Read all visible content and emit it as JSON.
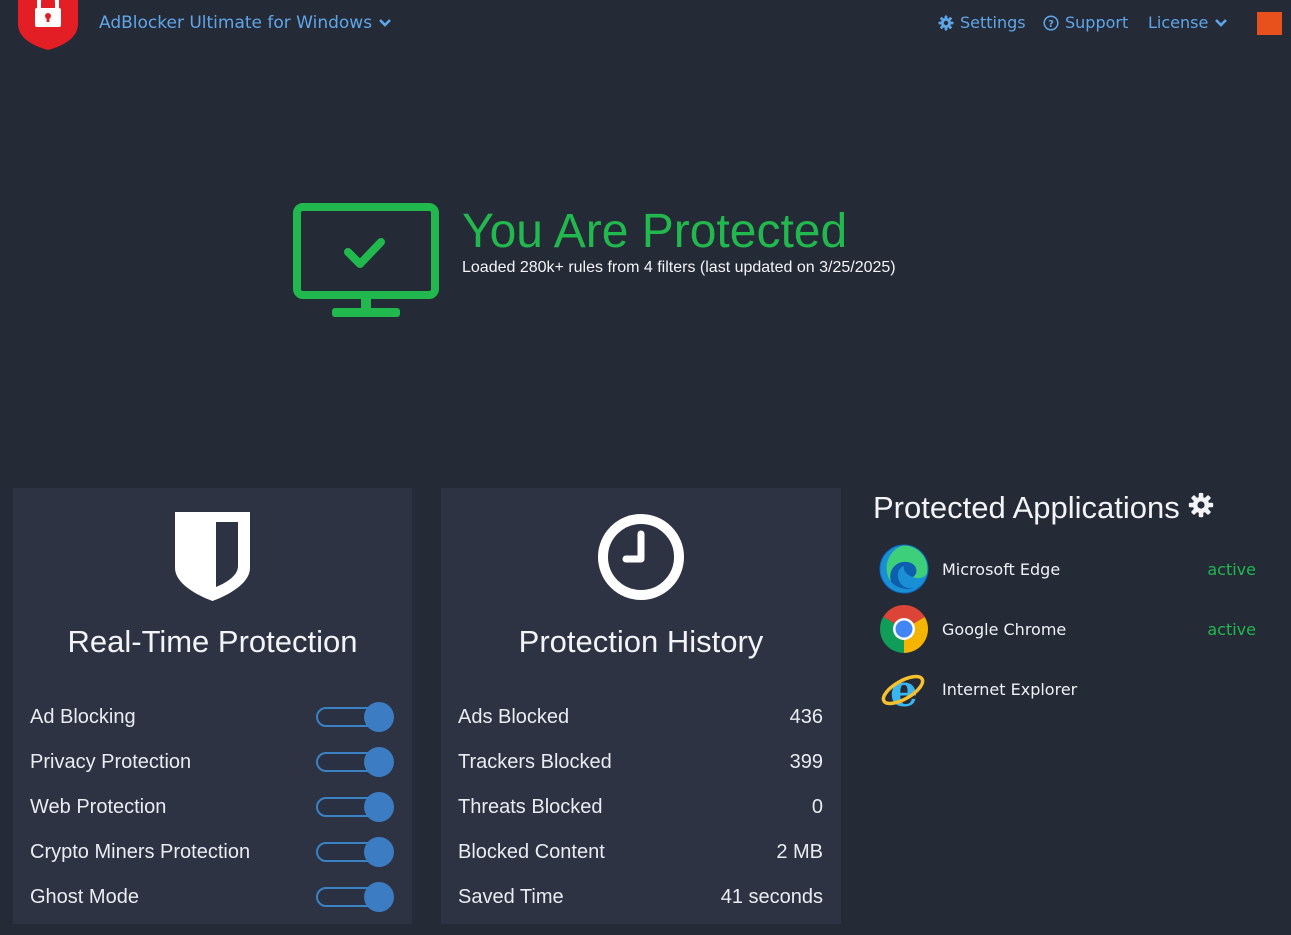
{
  "header": {
    "app_title": "AdBlocker Ultimate for Windows",
    "settings_label": "Settings",
    "support_label": "Support",
    "license_label": "License"
  },
  "hero": {
    "title": "You Are Protected",
    "subtitle": "Loaded 280k+ rules from 4 filters (last updated on 3/25/2025)"
  },
  "realtime": {
    "title": "Real-Time Protection",
    "items": [
      {
        "label": "Ad Blocking",
        "enabled": true
      },
      {
        "label": "Privacy Protection",
        "enabled": true
      },
      {
        "label": "Web Protection",
        "enabled": true
      },
      {
        "label": "Crypto Miners Protection",
        "enabled": true
      },
      {
        "label": "Ghost Mode",
        "enabled": true
      }
    ]
  },
  "history": {
    "title": "Protection History",
    "items": [
      {
        "label": "Ads Blocked",
        "value": "436"
      },
      {
        "label": "Trackers Blocked",
        "value": "399"
      },
      {
        "label": "Threats Blocked",
        "value": "0"
      },
      {
        "label": "Blocked Content",
        "value": "2 MB"
      },
      {
        "label": "Saved Time",
        "value": "41 seconds"
      }
    ]
  },
  "apps": {
    "title": "Protected Applications",
    "items": [
      {
        "name": "Microsoft Edge",
        "status": "active"
      },
      {
        "name": "Google Chrome",
        "status": "active"
      },
      {
        "name": "Internet Explorer",
        "status": ""
      }
    ]
  },
  "colors": {
    "accent": "#5fa6e8",
    "success": "#21b84e",
    "background": "#252a37",
    "card": "#2d3343",
    "toggle": "#3b7cc3",
    "close": "#e8501c"
  }
}
